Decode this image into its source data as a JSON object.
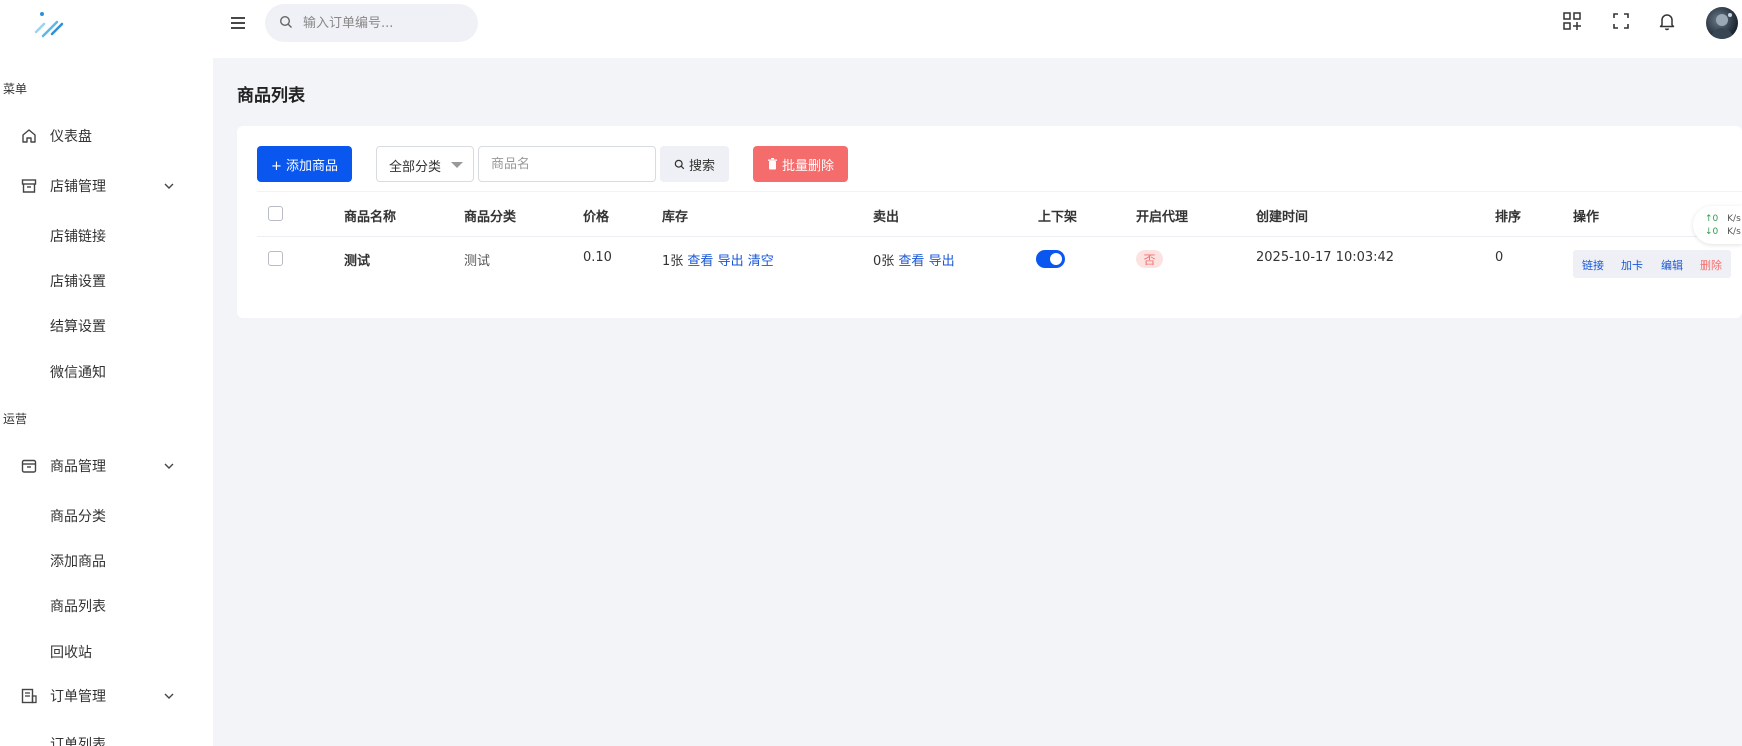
{
  "sidebar": {
    "sections": [
      {
        "label": "菜单"
      },
      {
        "label": "运营"
      }
    ],
    "items": [
      {
        "label": "仪表盘",
        "icon": "home-icon"
      },
      {
        "label": "店铺管理",
        "icon": "store-icon",
        "expanded": true
      },
      {
        "label": "店铺链接"
      },
      {
        "label": "店铺设置"
      },
      {
        "label": "结算设置"
      },
      {
        "label": "微信通知"
      },
      {
        "label": "商品管理",
        "icon": "box-icon",
        "expanded": true
      },
      {
        "label": "商品分类"
      },
      {
        "label": "添加商品"
      },
      {
        "label": "商品列表"
      },
      {
        "label": "回收站"
      },
      {
        "label": "订单管理",
        "icon": "order-icon",
        "expanded": true
      },
      {
        "label": "订单列表"
      }
    ]
  },
  "topbar": {
    "search_placeholder": "输入订单编号...",
    "icons": [
      "menu-icon",
      "qr-add-icon",
      "fullscreen-icon",
      "bell-icon",
      "avatar"
    ]
  },
  "page": {
    "title": "商品列表"
  },
  "toolbar": {
    "add_label": "+ 添加商品",
    "category_selected": "全部分类",
    "name_placeholder": "商品名",
    "search_label": "搜索",
    "batch_delete_label": "批量删除"
  },
  "table": {
    "columns": [
      "商品名称",
      "商品分类",
      "价格",
      "库存",
      "卖出",
      "上下架",
      "开启代理",
      "创建时间",
      "排序",
      "操作"
    ],
    "rows": [
      {
        "name": "测试",
        "category": "测试",
        "price": "0.10",
        "stock_count": "1张",
        "stock_view": "查看",
        "stock_export": "导出",
        "stock_clear": "清空",
        "sold_count": "0张",
        "sold_view": "查看",
        "sold_export": "导出",
        "listed": true,
        "proxy": "否",
        "created": "2025-10-17 10:03:42",
        "sort": "0",
        "ops": {
          "link": "链接",
          "add_card": "加卡",
          "edit": "编辑",
          "delete": "删除"
        }
      }
    ]
  },
  "net_speed": {
    "up": "↑0",
    "up_unit": "K/s",
    "down": "↓0",
    "down_unit": "K/s"
  },
  "colors": {
    "primary": "#0a57f0",
    "danger": "#f56c6c",
    "link": "#1957d6",
    "background": "#f3f4f8"
  }
}
